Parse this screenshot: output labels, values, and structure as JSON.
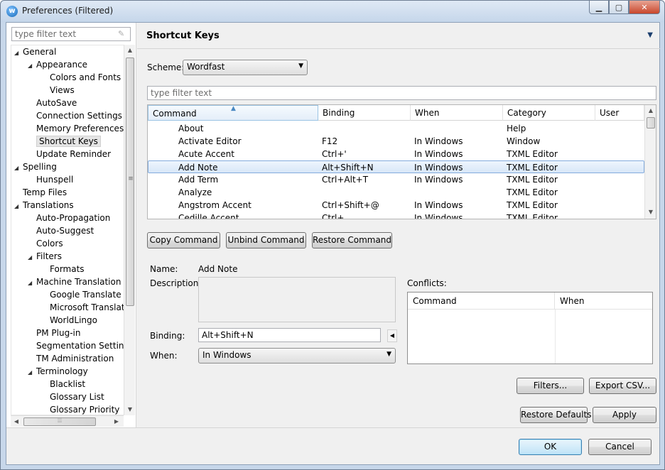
{
  "window": {
    "title": "Preferences (Filtered)",
    "icon": "wordfast-app-icon"
  },
  "filter": {
    "placeholder": "type filter text"
  },
  "tree": [
    {
      "label": "General",
      "level": 0,
      "expanded": true
    },
    {
      "label": "Appearance",
      "level": 1,
      "expanded": true
    },
    {
      "label": "Colors and Fonts",
      "level": 2
    },
    {
      "label": "Views",
      "level": 2
    },
    {
      "label": "AutoSave",
      "level": 1
    },
    {
      "label": "Connection Settings",
      "level": 1
    },
    {
      "label": "Memory Preferences",
      "level": 1
    },
    {
      "label": "Shortcut Keys",
      "level": 1,
      "selected": true
    },
    {
      "label": "Update Reminder",
      "level": 1
    },
    {
      "label": "Spelling",
      "level": 0,
      "expanded": true
    },
    {
      "label": "Hunspell",
      "level": 1
    },
    {
      "label": "Temp Files",
      "level": 0
    },
    {
      "label": "Translations",
      "level": 0,
      "expanded": true
    },
    {
      "label": "Auto-Propagation",
      "level": 1
    },
    {
      "label": "Auto-Suggest",
      "level": 1
    },
    {
      "label": "Colors",
      "level": 1
    },
    {
      "label": "Filters",
      "level": 1,
      "expanded": true
    },
    {
      "label": "Formats",
      "level": 2
    },
    {
      "label": "Machine Translation",
      "level": 1,
      "expanded": true
    },
    {
      "label": "Google Translate",
      "level": 2
    },
    {
      "label": "Microsoft Translator",
      "level": 2
    },
    {
      "label": "WorldLingo",
      "level": 2
    },
    {
      "label": "PM Plug-in",
      "level": 1
    },
    {
      "label": "Segmentation Settings",
      "level": 1
    },
    {
      "label": "TM Administration",
      "level": 1
    },
    {
      "label": "Terminology",
      "level": 1,
      "expanded": true
    },
    {
      "label": "Blacklist",
      "level": 2
    },
    {
      "label": "Glossary List",
      "level": 2
    },
    {
      "label": "Glossary Priority",
      "level": 2
    }
  ],
  "page": {
    "title": "Shortcut Keys"
  },
  "scheme": {
    "label": "Scheme:",
    "value": "Wordfast"
  },
  "table_filter": {
    "placeholder": "type filter text"
  },
  "table": {
    "columns": [
      "Command",
      "Binding",
      "When",
      "Category",
      "User"
    ],
    "rows": [
      {
        "command": "About",
        "binding": "",
        "when": "",
        "category": "Help"
      },
      {
        "command": "Activate Editor",
        "binding": "F12",
        "when": "In Windows",
        "category": "Window"
      },
      {
        "command": "Acute Accent",
        "binding": "Ctrl+'",
        "when": "In Windows",
        "category": "TXML Editor"
      },
      {
        "command": "Add Note",
        "binding": "Alt+Shift+N",
        "when": "In Windows",
        "category": "TXML Editor",
        "selected": true
      },
      {
        "command": "Add Term",
        "binding": "Ctrl+Alt+T",
        "when": "In Windows",
        "category": "TXML Editor"
      },
      {
        "command": "Analyze",
        "binding": "",
        "when": "",
        "category": "TXML Editor"
      },
      {
        "command": "Angstrom Accent",
        "binding": "Ctrl+Shift+@",
        "when": "In Windows",
        "category": "TXML Editor"
      },
      {
        "command": "Cedille Accent",
        "binding": "Ctrl+,",
        "when": "In Windows",
        "category": "TXML Editor"
      }
    ]
  },
  "buttons": {
    "copy_command": "Copy Command",
    "unbind_command": "Unbind Command",
    "restore_command": "Restore Command",
    "filters": "Filters...",
    "export_csv": "Export CSV...",
    "restore_defaults": "Restore Defaults",
    "apply": "Apply",
    "ok": "OK",
    "cancel": "Cancel"
  },
  "details": {
    "name_label": "Name:",
    "name_value": "Add Note",
    "description_label": "Description:",
    "binding_label": "Binding:",
    "binding_value": "Alt+Shift+N",
    "when_label": "When:",
    "when_value": "In Windows",
    "conflicts_label": "Conflicts:",
    "conflicts_columns": [
      "Command",
      "When"
    ]
  }
}
